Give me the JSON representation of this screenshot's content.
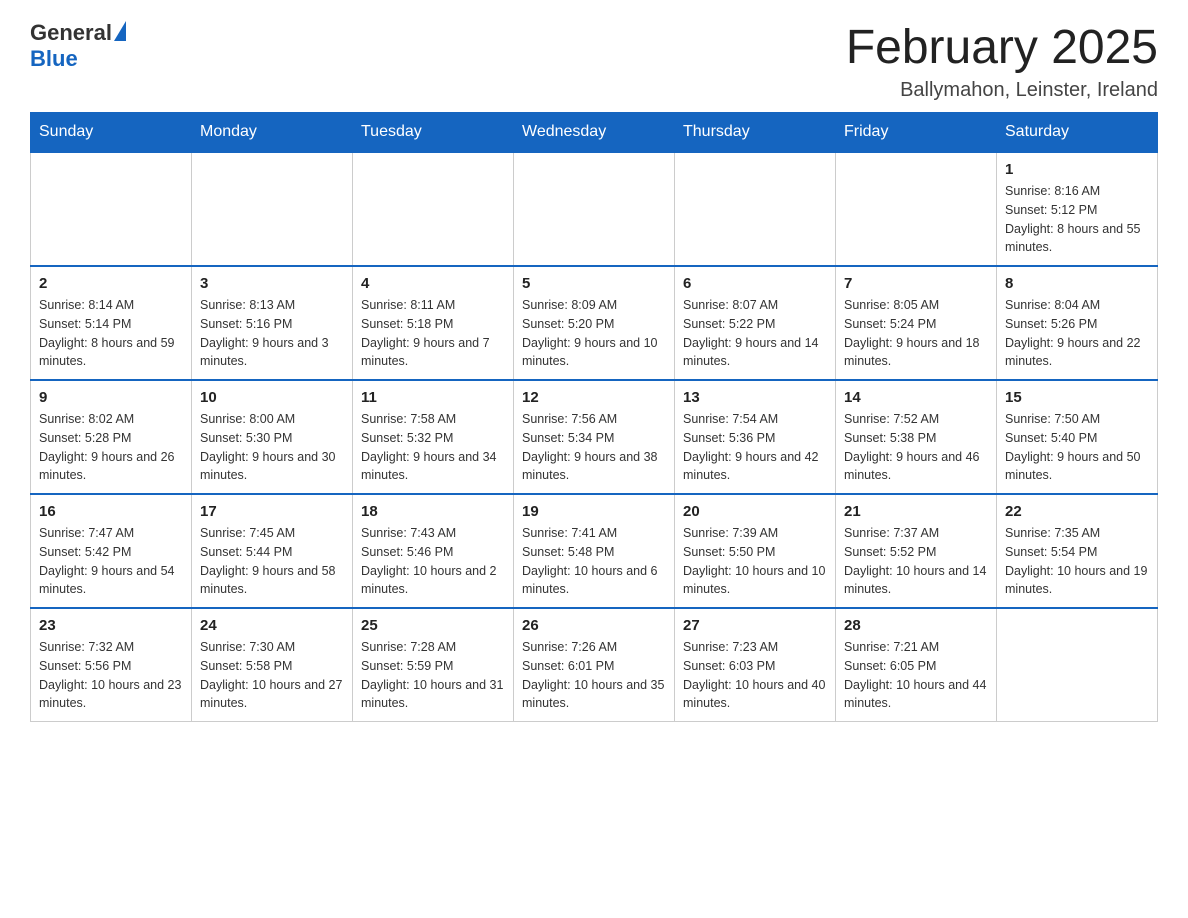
{
  "header": {
    "logo_general": "General",
    "logo_blue": "Blue",
    "title": "February 2025",
    "subtitle": "Ballymahon, Leinster, Ireland"
  },
  "weekdays": [
    "Sunday",
    "Monday",
    "Tuesday",
    "Wednesday",
    "Thursday",
    "Friday",
    "Saturday"
  ],
  "weeks": [
    [
      {
        "day": "",
        "info": ""
      },
      {
        "day": "",
        "info": ""
      },
      {
        "day": "",
        "info": ""
      },
      {
        "day": "",
        "info": ""
      },
      {
        "day": "",
        "info": ""
      },
      {
        "day": "",
        "info": ""
      },
      {
        "day": "1",
        "info": "Sunrise: 8:16 AM\nSunset: 5:12 PM\nDaylight: 8 hours and 55 minutes."
      }
    ],
    [
      {
        "day": "2",
        "info": "Sunrise: 8:14 AM\nSunset: 5:14 PM\nDaylight: 8 hours and 59 minutes."
      },
      {
        "day": "3",
        "info": "Sunrise: 8:13 AM\nSunset: 5:16 PM\nDaylight: 9 hours and 3 minutes."
      },
      {
        "day": "4",
        "info": "Sunrise: 8:11 AM\nSunset: 5:18 PM\nDaylight: 9 hours and 7 minutes."
      },
      {
        "day": "5",
        "info": "Sunrise: 8:09 AM\nSunset: 5:20 PM\nDaylight: 9 hours and 10 minutes."
      },
      {
        "day": "6",
        "info": "Sunrise: 8:07 AM\nSunset: 5:22 PM\nDaylight: 9 hours and 14 minutes."
      },
      {
        "day": "7",
        "info": "Sunrise: 8:05 AM\nSunset: 5:24 PM\nDaylight: 9 hours and 18 minutes."
      },
      {
        "day": "8",
        "info": "Sunrise: 8:04 AM\nSunset: 5:26 PM\nDaylight: 9 hours and 22 minutes."
      }
    ],
    [
      {
        "day": "9",
        "info": "Sunrise: 8:02 AM\nSunset: 5:28 PM\nDaylight: 9 hours and 26 minutes."
      },
      {
        "day": "10",
        "info": "Sunrise: 8:00 AM\nSunset: 5:30 PM\nDaylight: 9 hours and 30 minutes."
      },
      {
        "day": "11",
        "info": "Sunrise: 7:58 AM\nSunset: 5:32 PM\nDaylight: 9 hours and 34 minutes."
      },
      {
        "day": "12",
        "info": "Sunrise: 7:56 AM\nSunset: 5:34 PM\nDaylight: 9 hours and 38 minutes."
      },
      {
        "day": "13",
        "info": "Sunrise: 7:54 AM\nSunset: 5:36 PM\nDaylight: 9 hours and 42 minutes."
      },
      {
        "day": "14",
        "info": "Sunrise: 7:52 AM\nSunset: 5:38 PM\nDaylight: 9 hours and 46 minutes."
      },
      {
        "day": "15",
        "info": "Sunrise: 7:50 AM\nSunset: 5:40 PM\nDaylight: 9 hours and 50 minutes."
      }
    ],
    [
      {
        "day": "16",
        "info": "Sunrise: 7:47 AM\nSunset: 5:42 PM\nDaylight: 9 hours and 54 minutes."
      },
      {
        "day": "17",
        "info": "Sunrise: 7:45 AM\nSunset: 5:44 PM\nDaylight: 9 hours and 58 minutes."
      },
      {
        "day": "18",
        "info": "Sunrise: 7:43 AM\nSunset: 5:46 PM\nDaylight: 10 hours and 2 minutes."
      },
      {
        "day": "19",
        "info": "Sunrise: 7:41 AM\nSunset: 5:48 PM\nDaylight: 10 hours and 6 minutes."
      },
      {
        "day": "20",
        "info": "Sunrise: 7:39 AM\nSunset: 5:50 PM\nDaylight: 10 hours and 10 minutes."
      },
      {
        "day": "21",
        "info": "Sunrise: 7:37 AM\nSunset: 5:52 PM\nDaylight: 10 hours and 14 minutes."
      },
      {
        "day": "22",
        "info": "Sunrise: 7:35 AM\nSunset: 5:54 PM\nDaylight: 10 hours and 19 minutes."
      }
    ],
    [
      {
        "day": "23",
        "info": "Sunrise: 7:32 AM\nSunset: 5:56 PM\nDaylight: 10 hours and 23 minutes."
      },
      {
        "day": "24",
        "info": "Sunrise: 7:30 AM\nSunset: 5:58 PM\nDaylight: 10 hours and 27 minutes."
      },
      {
        "day": "25",
        "info": "Sunrise: 7:28 AM\nSunset: 5:59 PM\nDaylight: 10 hours and 31 minutes."
      },
      {
        "day": "26",
        "info": "Sunrise: 7:26 AM\nSunset: 6:01 PM\nDaylight: 10 hours and 35 minutes."
      },
      {
        "day": "27",
        "info": "Sunrise: 7:23 AM\nSunset: 6:03 PM\nDaylight: 10 hours and 40 minutes."
      },
      {
        "day": "28",
        "info": "Sunrise: 7:21 AM\nSunset: 6:05 PM\nDaylight: 10 hours and 44 minutes."
      },
      {
        "day": "",
        "info": ""
      }
    ]
  ]
}
